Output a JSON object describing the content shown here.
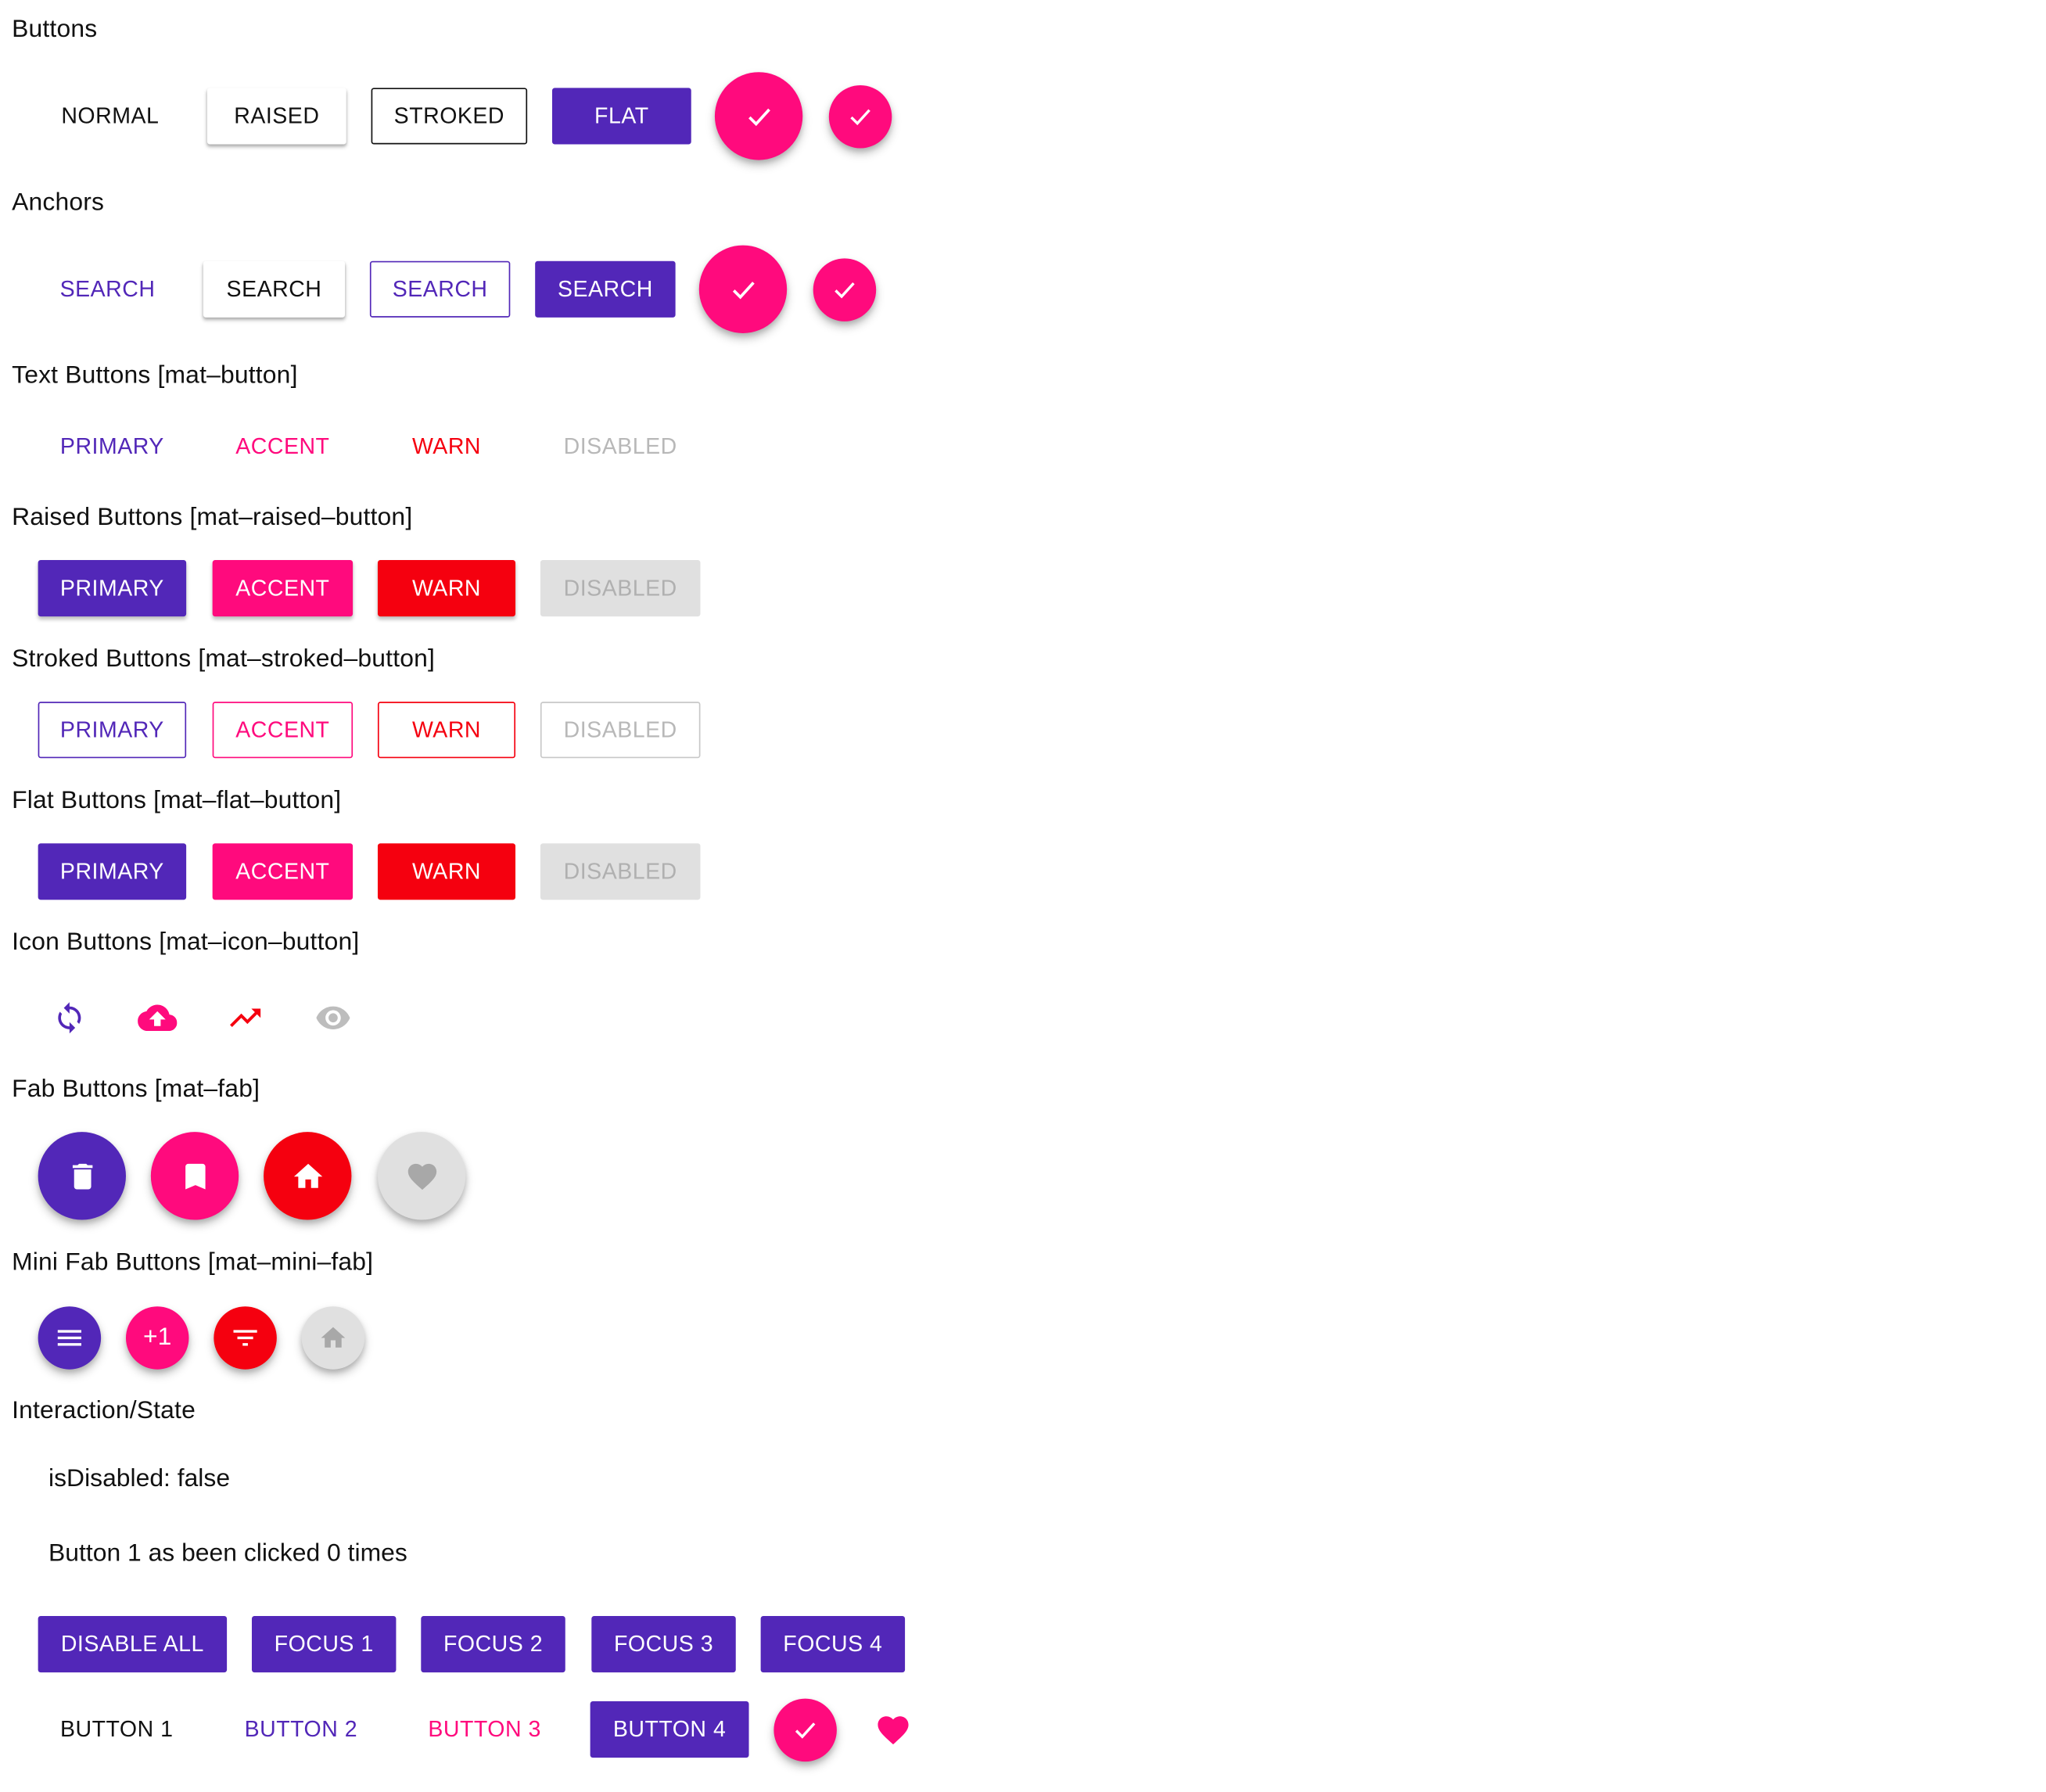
{
  "colors": {
    "primary": "#5227b8",
    "accent": "#ff0a7d",
    "warn": "#f5000f",
    "disabled_text": "#b8b8b8",
    "disabled_bg": "#e0e0e0"
  },
  "sections": {
    "buttons": "Buttons",
    "anchors": "Anchors",
    "text": "Text Buttons [mat–button]",
    "raised": "Raised Buttons [mat–raised–button]",
    "stroked": "Stroked Buttons [mat–stroked–button]",
    "flat": "Flat Buttons [mat–flat–button]",
    "icon": "Icon Buttons [mat–icon–button]",
    "fab": "Fab Buttons [mat–fab]",
    "mini": "Mini Fab Buttons [mat–mini–fab]",
    "interaction": "Interaction/State"
  },
  "buttons_row": {
    "normal": "NORMAL",
    "raised": "RAISED",
    "stroked": "STROKED",
    "flat": "FLAT"
  },
  "anchors_row": {
    "label": "SEARCH"
  },
  "variants": {
    "primary": "PRIMARY",
    "accent": "ACCENT",
    "warn": "WARN",
    "disabled": "DISABLED"
  },
  "icons": {
    "fab_check": "check-icon",
    "icon_row": [
      "sync-icon",
      "cloud-upload-icon",
      "trending-up-icon",
      "visibility-icon"
    ],
    "fab_row": [
      "delete-icon",
      "bookmark-icon",
      "home-icon",
      "favorite-icon"
    ],
    "mini_row": [
      "menu-icon",
      "plus-one-icon",
      "filter-list-icon",
      "home-icon"
    ]
  },
  "mini_plus_one": "+1",
  "state": {
    "is_disabled": "isDisabled: false",
    "click_count": "Button 1 as been clicked 0 times"
  },
  "controls": [
    "DISABLE ALL",
    "FOCUS 1",
    "FOCUS 2",
    "FOCUS 3",
    "FOCUS 4"
  ],
  "demo": [
    "BUTTON 1",
    "BUTTON 2",
    "BUTTON 3",
    "BUTTON 4"
  ]
}
